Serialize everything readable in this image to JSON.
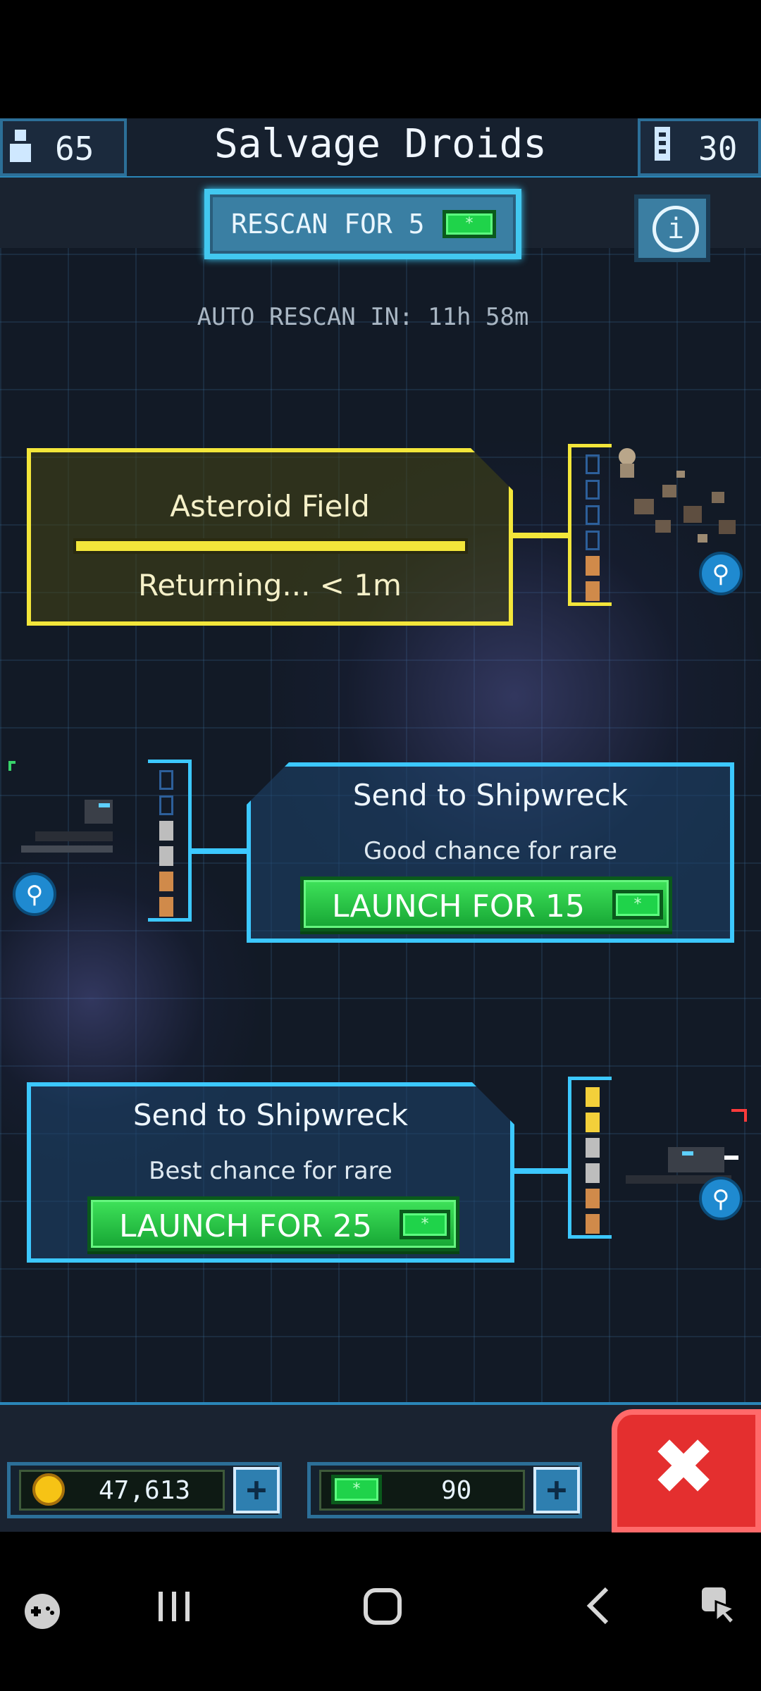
{
  "topbar": {
    "crew_count": "65",
    "title": "Salvage Droids",
    "droid_count": "30"
  },
  "rescan": {
    "label": "RESCAN FOR 5",
    "auto_text": "AUTO RESCAN IN: 11h 58m"
  },
  "missions": [
    {
      "title": "Asteroid Field",
      "status": "Returning... < 1m",
      "progress": 1.0
    },
    {
      "title": "Send to Shipwreck",
      "subtitle": "Good chance for rare",
      "launch_label": "LAUNCH FOR 15"
    },
    {
      "title": "Send to Shipwreck",
      "subtitle": "Best chance for rare",
      "launch_label": "LAUNCH FOR 25"
    }
  ],
  "resources": {
    "coins": "47,613",
    "gems": "90"
  },
  "colors": {
    "active_mission": "#f3e63a",
    "available_mission": "#3cc8ff",
    "launch_green": "#2bd24a",
    "close_red": "#e42f2f"
  },
  "icons": {
    "crew": "person-icon",
    "droid": "droid-icon",
    "info": "info-icon",
    "zoom": "magnifier-icon",
    "coin": "coin-icon",
    "gem": "gem-icon",
    "close": "close-icon"
  }
}
